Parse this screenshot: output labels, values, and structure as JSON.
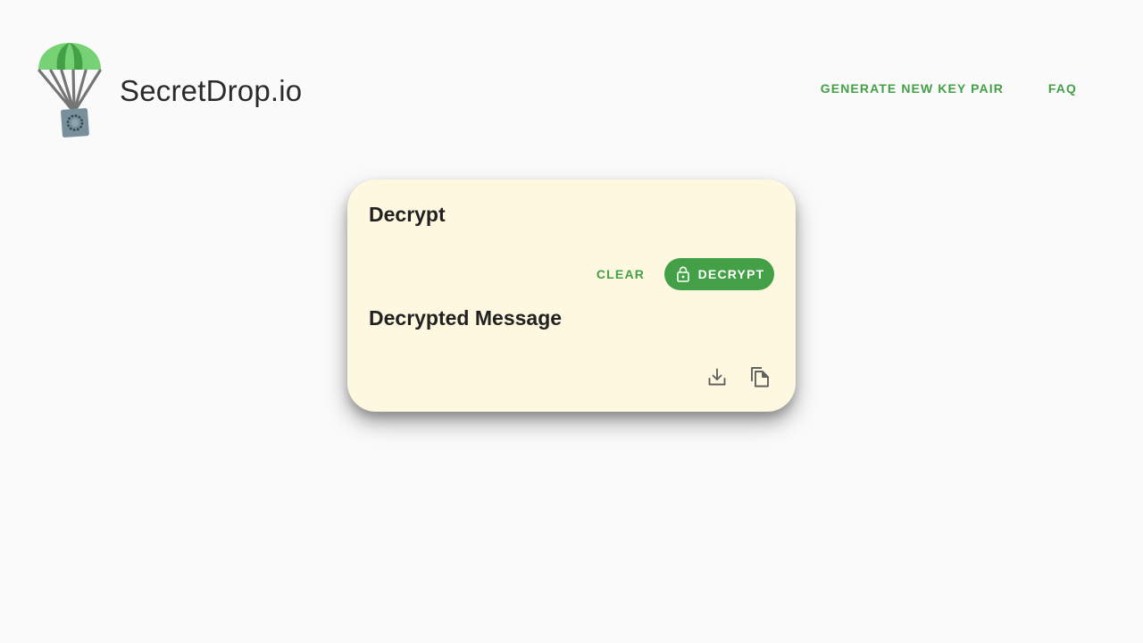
{
  "brand": {
    "name": "SecretDrop.io"
  },
  "nav": {
    "generate_label": "GENERATE NEW KEY PAIR",
    "faq_label": "FAQ"
  },
  "card": {
    "title": "Decrypt",
    "clear_label": "CLEAR",
    "decrypt_label": "DECRYPT",
    "decrypted_title": "Decrypted Message"
  },
  "icons": {
    "logo": "parachute-safe-logo-icon",
    "lock": "lock-icon",
    "download": "download-icon",
    "copy": "copy-icon"
  },
  "colors": {
    "accent": "#43a047",
    "card_bg": "#fff8e1",
    "icon_gray": "#616161",
    "background": "#fafafa"
  }
}
